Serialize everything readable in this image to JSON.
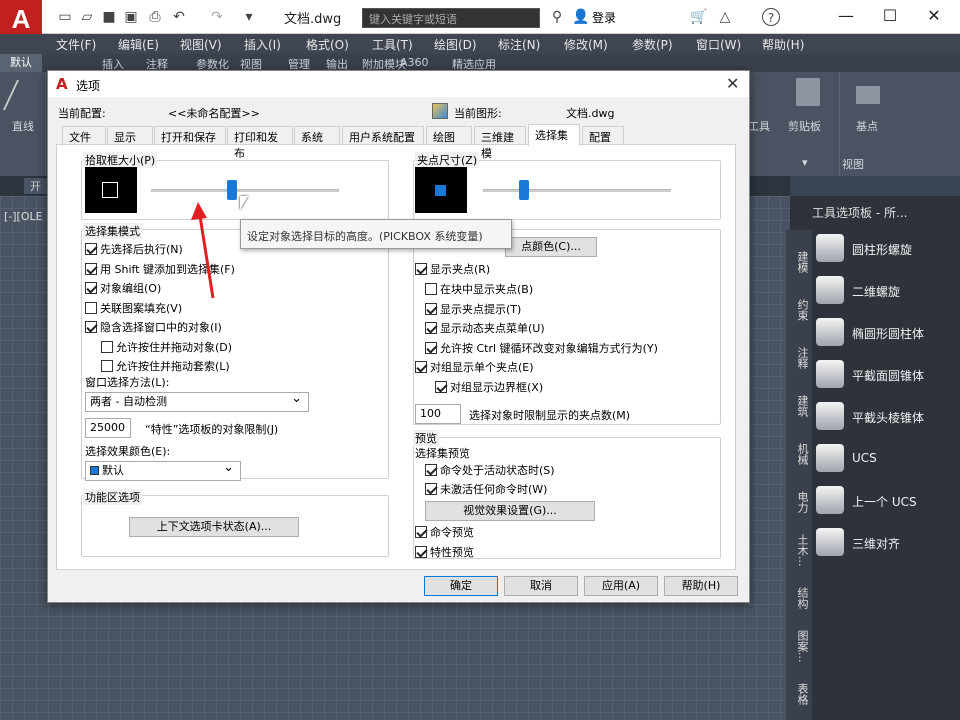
{
  "app": {
    "logo": "A",
    "doc_title": "文档.dwg",
    "search_placeholder": "键入关键字或短语",
    "login": "登录"
  },
  "window_controls": {
    "minimize": "—",
    "maximize": "☐",
    "close": "✕"
  },
  "menubar": [
    "文件(F)",
    "编辑(E)",
    "视图(V)",
    "插入(I)",
    "格式(O)",
    "工具(T)",
    "绘图(D)",
    "标注(N)",
    "修改(M)",
    "参数(P)",
    "窗口(W)",
    "帮助(H)"
  ],
  "ribbon_tabs": [
    "默认",
    "插入",
    "注释",
    "参数化",
    "视图",
    "管理",
    "输出",
    "附加模块",
    "A360",
    "精选应用"
  ],
  "ribbon": {
    "line": "直线",
    "tools": "工具",
    "clipboard": "剪贴板",
    "base": "基点",
    "view": "视图"
  },
  "filetab": "开",
  "viewport_label": "[-][OLE",
  "palette": {
    "title": "工具选项板 - 所...",
    "tabs": [
      "建模",
      "约束",
      "注释",
      "建筑",
      "机械",
      "电力",
      "土木...",
      "结构",
      "图案...",
      "表格"
    ],
    "items": [
      "圆柱形螺旋",
      "二维螺旋",
      "椭圆形圆柱体",
      "平截面圆锥体",
      "平截头棱锥体",
      "UCS",
      "上一个 UCS",
      "三维对齐"
    ]
  },
  "dialog": {
    "title": "选项",
    "current_profile_label": "当前配置:",
    "current_profile": "<<未命名配置>>",
    "current_drawing_label": "当前图形:",
    "current_drawing": "文档.dwg",
    "tabs": [
      "文件",
      "显示",
      "打开和保存",
      "打印和发布",
      "系统",
      "用户系统配置",
      "绘图",
      "三维建模",
      "选择集",
      "配置"
    ],
    "active_tab": "选择集",
    "pickbox": {
      "legend": "拾取框大小(P)",
      "slider": 0.43
    },
    "grip": {
      "legend": "夹点尺寸(Z)",
      "slider": 0.22
    },
    "tooltip": "设定对象选择目标的高度。(PICKBOX 系统变量)",
    "selection_modes": {
      "legend": "选择集模式",
      "items": [
        {
          "label": "先选择后执行(N)",
          "checked": true
        },
        {
          "label": "用 Shift 键添加到选择集(F)",
          "checked": true
        },
        {
          "label": "对象编组(O)",
          "checked": true
        },
        {
          "label": "关联图案填充(V)",
          "checked": false
        },
        {
          "label": "隐含选择窗口中的对象(I)",
          "checked": true
        },
        {
          "label": "允许按住并拖动对象(D)",
          "checked": false
        },
        {
          "label": "允许按住并拖动套索(L)",
          "checked": false
        }
      ]
    },
    "window_method_label": "窗口选择方法(L):",
    "window_method_value": "两者 - 自动检测",
    "limit_value": "25000",
    "limit_label": "“特性”选项板的对象限制(J)",
    "effect_color_label": "选择效果颜色(E):",
    "effect_color_value": "默认",
    "ribbon_options": {
      "legend": "功能区选项",
      "button": "上下文选项卡状态(A)..."
    },
    "grips": {
      "color_button": "点颜色(C)...",
      "items": [
        {
          "label": "显示夹点(R)",
          "checked": true
        },
        {
          "label": "在块中显示夹点(B)",
          "checked": false
        },
        {
          "label": "显示夹点提示(T)",
          "checked": true
        },
        {
          "label": "显示动态夹点菜单(U)",
          "checked": true
        },
        {
          "label": "允许按 Ctrl 键循环改变对象编辑方式行为(Y)",
          "checked": true
        },
        {
          "label": "对组显示单个夹点(E)",
          "checked": true
        },
        {
          "label": "对组显示边界框(X)",
          "checked": true
        }
      ],
      "limit_value": "100",
      "limit_label": "选择对象时限制显示的夹点数(M)"
    },
    "preview": {
      "legend": "预览",
      "sub": "选择集预览",
      "items": [
        {
          "label": "命令处于活动状态时(S)",
          "checked": true
        },
        {
          "label": "未激活任何命令时(W)",
          "checked": true
        }
      ],
      "visual_button": "视觉效果设置(G)...",
      "cmd_preview": {
        "label": "命令预览",
        "checked": true
      },
      "prop_preview": {
        "label": "特性预览",
        "checked": true
      }
    },
    "buttons": {
      "ok": "确定",
      "cancel": "取消",
      "apply": "应用(A)",
      "help": "帮助(H)"
    }
  },
  "colors": {
    "accent": "#1a79d6",
    "logo_red": "#c21f1f",
    "arrow": "#e02020"
  }
}
